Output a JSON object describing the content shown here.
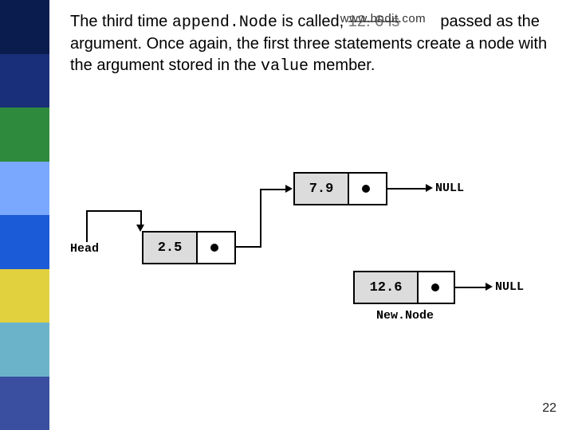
{
  "sidebar": {
    "colors": [
      "darknavy",
      "darkblue",
      "green",
      "skyblue",
      "blue",
      "yellow",
      "cyan",
      "swatch"
    ]
  },
  "paragraph": {
    "t1": "The third time ",
    "code1": "append.Node",
    "t2": " is called, ",
    "watermark_overlay": "www.hndit.com",
    "t_hidden_num": "12. 6 is",
    "t3": " passed as the argument. Once again, the first three statements create a node with the argument stored in the ",
    "code2": "value",
    "t4": " member."
  },
  "diagram": {
    "head_label": "Head",
    "node1_value": "2.5",
    "node2_value": "7.9",
    "node3_value": "12.6",
    "null_label_top": "NULL",
    "null_label_bottom": "NULL",
    "newnode_label": "New.Node"
  },
  "page_number": "22"
}
